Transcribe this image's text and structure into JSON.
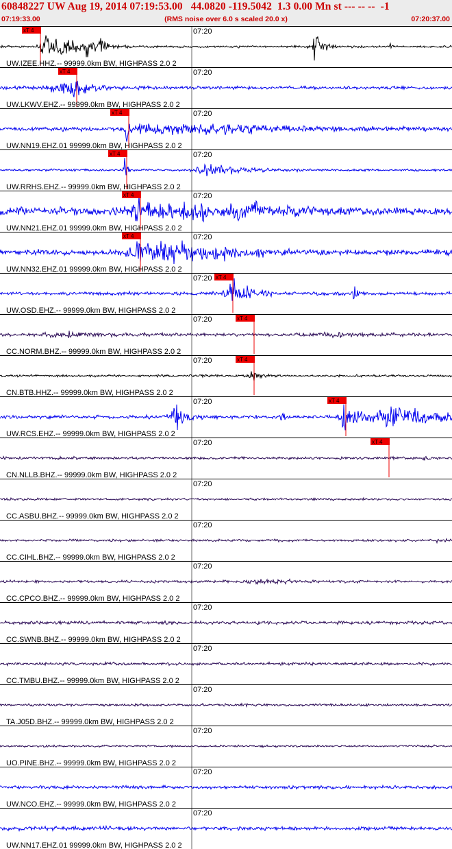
{
  "header": {
    "title": "60848227 UW Aug 19, 2014 07:19:53.00   44.0820 -119.5042  1.3 0.00 Mn st --- -- --  -1",
    "start_time": "07:19:33.00",
    "rms_note": "(RMS noise over 6.0 s scaled 20.0 x)",
    "end_time": "07:20:37.00",
    "bg_color": "#ececec",
    "text_color": "#cc0000"
  },
  "minute_tick_label": "07:20",
  "pick_marker_label": "xT 4",
  "pick_color": "#ee0000",
  "traces": [
    {
      "label": "UW.IZEE.HHZ.-- 99999.0km BW, HIGHPASS  2.0  2",
      "color": "#000000",
      "pick": true,
      "pick_at": 0.09
    },
    {
      "label": "UW.LKWV.EHZ.-- 99999.0km BW, HIGHPASS  2.0  2",
      "color": "#0000ee",
      "pick": true,
      "pick_at": 0.17
    },
    {
      "label": "UW.NN19.EHZ.01 99999.0km BW, HIGHPASS  2.0  2",
      "color": "#0000ee",
      "pick": true,
      "pick_at": 0.285
    },
    {
      "label": "UW.RRHS.EHZ.-- 99999.0km BW, HIGHPASS  2.0  2",
      "color": "#0000ee",
      "pick": true,
      "pick_at": 0.28
    },
    {
      "label": "UW.NN21.EHZ.01 99999.0km BW, HIGHPASS  2.0  2",
      "color": "#0000ee",
      "pick": true,
      "pick_at": 0.31
    },
    {
      "label": "UW.NN32.EHZ.01 99999.0km BW, HIGHPASS  2.0  2",
      "color": "#0000ee",
      "pick": true,
      "pick_at": 0.31
    },
    {
      "label": "UW.OSD.EHZ.-- 99999.0km BW, HIGHPASS  2.0  2",
      "color": "#0000ee",
      "pick": true,
      "pick_at": 0.515
    },
    {
      "label": "CC.NORM.BHZ.-- 99999.0km BW, HIGHPASS  2.0  2",
      "color": "#2a0a55",
      "pick": true,
      "pick_at": 0.562
    },
    {
      "label": "CN.BTB.HHZ.-- 99999.0km BW, HIGHPASS  2.0  2",
      "color": "#000000",
      "pick": true,
      "pick_at": 0.562
    },
    {
      "label": "UW.RCS.EHZ.-- 99999.0km BW, HIGHPASS  2.0  2",
      "color": "#0000ee",
      "pick": true,
      "pick_at": 0.765
    },
    {
      "label": "CN.NLLB.BHZ.-- 99999.0km BW, HIGHPASS  2.0  2",
      "color": "#2a0a55",
      "pick": true,
      "pick_at": 0.86
    },
    {
      "label": "CC.ASBU.BHZ.-- 99999.0km BW, HIGHPASS  2.0  2",
      "color": "#2a0a55",
      "pick": false,
      "pick_at": null
    },
    {
      "label": "CC.CIHL.BHZ.-- 99999.0km BW, HIGHPASS  2.0  2",
      "color": "#2a0a55",
      "pick": false,
      "pick_at": null
    },
    {
      "label": "CC.CPCO.BHZ.-- 99999.0km BW, HIGHPASS  2.0  2",
      "color": "#2a0a55",
      "pick": false,
      "pick_at": null
    },
    {
      "label": "CC.SWNB.BHZ.-- 99999.0km BW, HIGHPASS  2.0  2",
      "color": "#2a0a55",
      "pick": false,
      "pick_at": null
    },
    {
      "label": "CC.TMBU.BHZ.-- 99999.0km BW, HIGHPASS  2.0  2",
      "color": "#2a0a55",
      "pick": false,
      "pick_at": null
    },
    {
      "label": "TA.J05D.BHZ.-- 99999.0km BW, HIGHPASS  2.0  2",
      "color": "#2a0a55",
      "pick": false,
      "pick_at": null
    },
    {
      "label": "UO.PINE.BHZ.-- 99999.0km BW, HIGHPASS  2.0  2",
      "color": "#2a0a55",
      "pick": false,
      "pick_at": null
    },
    {
      "label": "UW.NCO.EHZ.-- 99999.0km BW, HIGHPASS  2.0  2",
      "color": "#0000ee",
      "pick": false,
      "pick_at": null
    },
    {
      "label": "UW.NN17.EHZ.01 99999.0km BW, HIGHPASS  2.0  2",
      "color": "#0000ee",
      "pick": false,
      "pick_at": null
    }
  ]
}
